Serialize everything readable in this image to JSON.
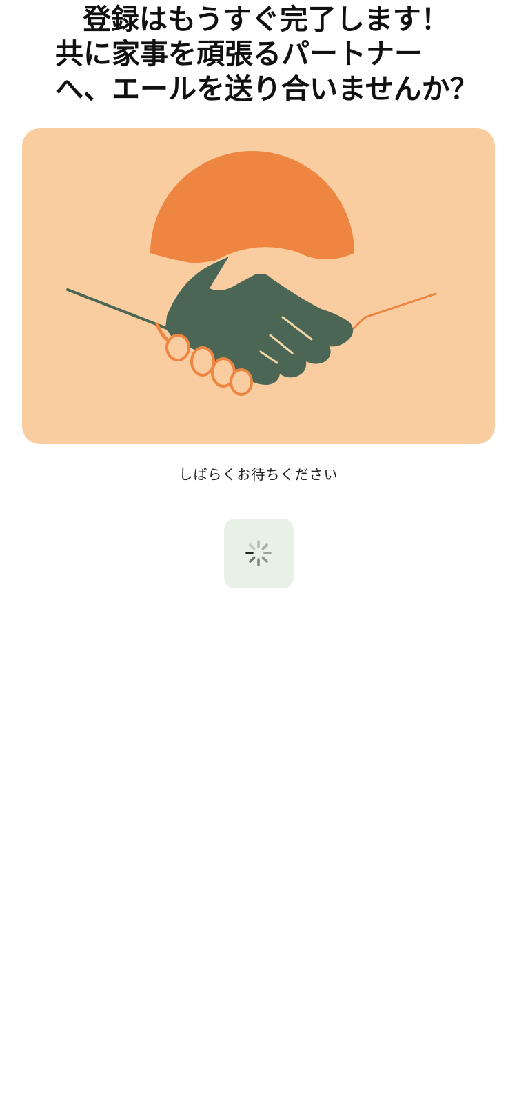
{
  "heading": {
    "line1": "登録はもうすぐ完了します！",
    "line2": "共に家事を頑張るパートナー",
    "line3": "へ、エールを送り合いませんか？"
  },
  "illustration": {
    "icon": "handshake-illustration",
    "background_color": "#f9cda0",
    "accent_color": "#ee8540",
    "hand_color": "#4b6655"
  },
  "status": {
    "message": "しばらくお待ちください",
    "spinner_icon": "loading-spinner-icon",
    "spinner_bg_color": "#e7f1e6"
  }
}
